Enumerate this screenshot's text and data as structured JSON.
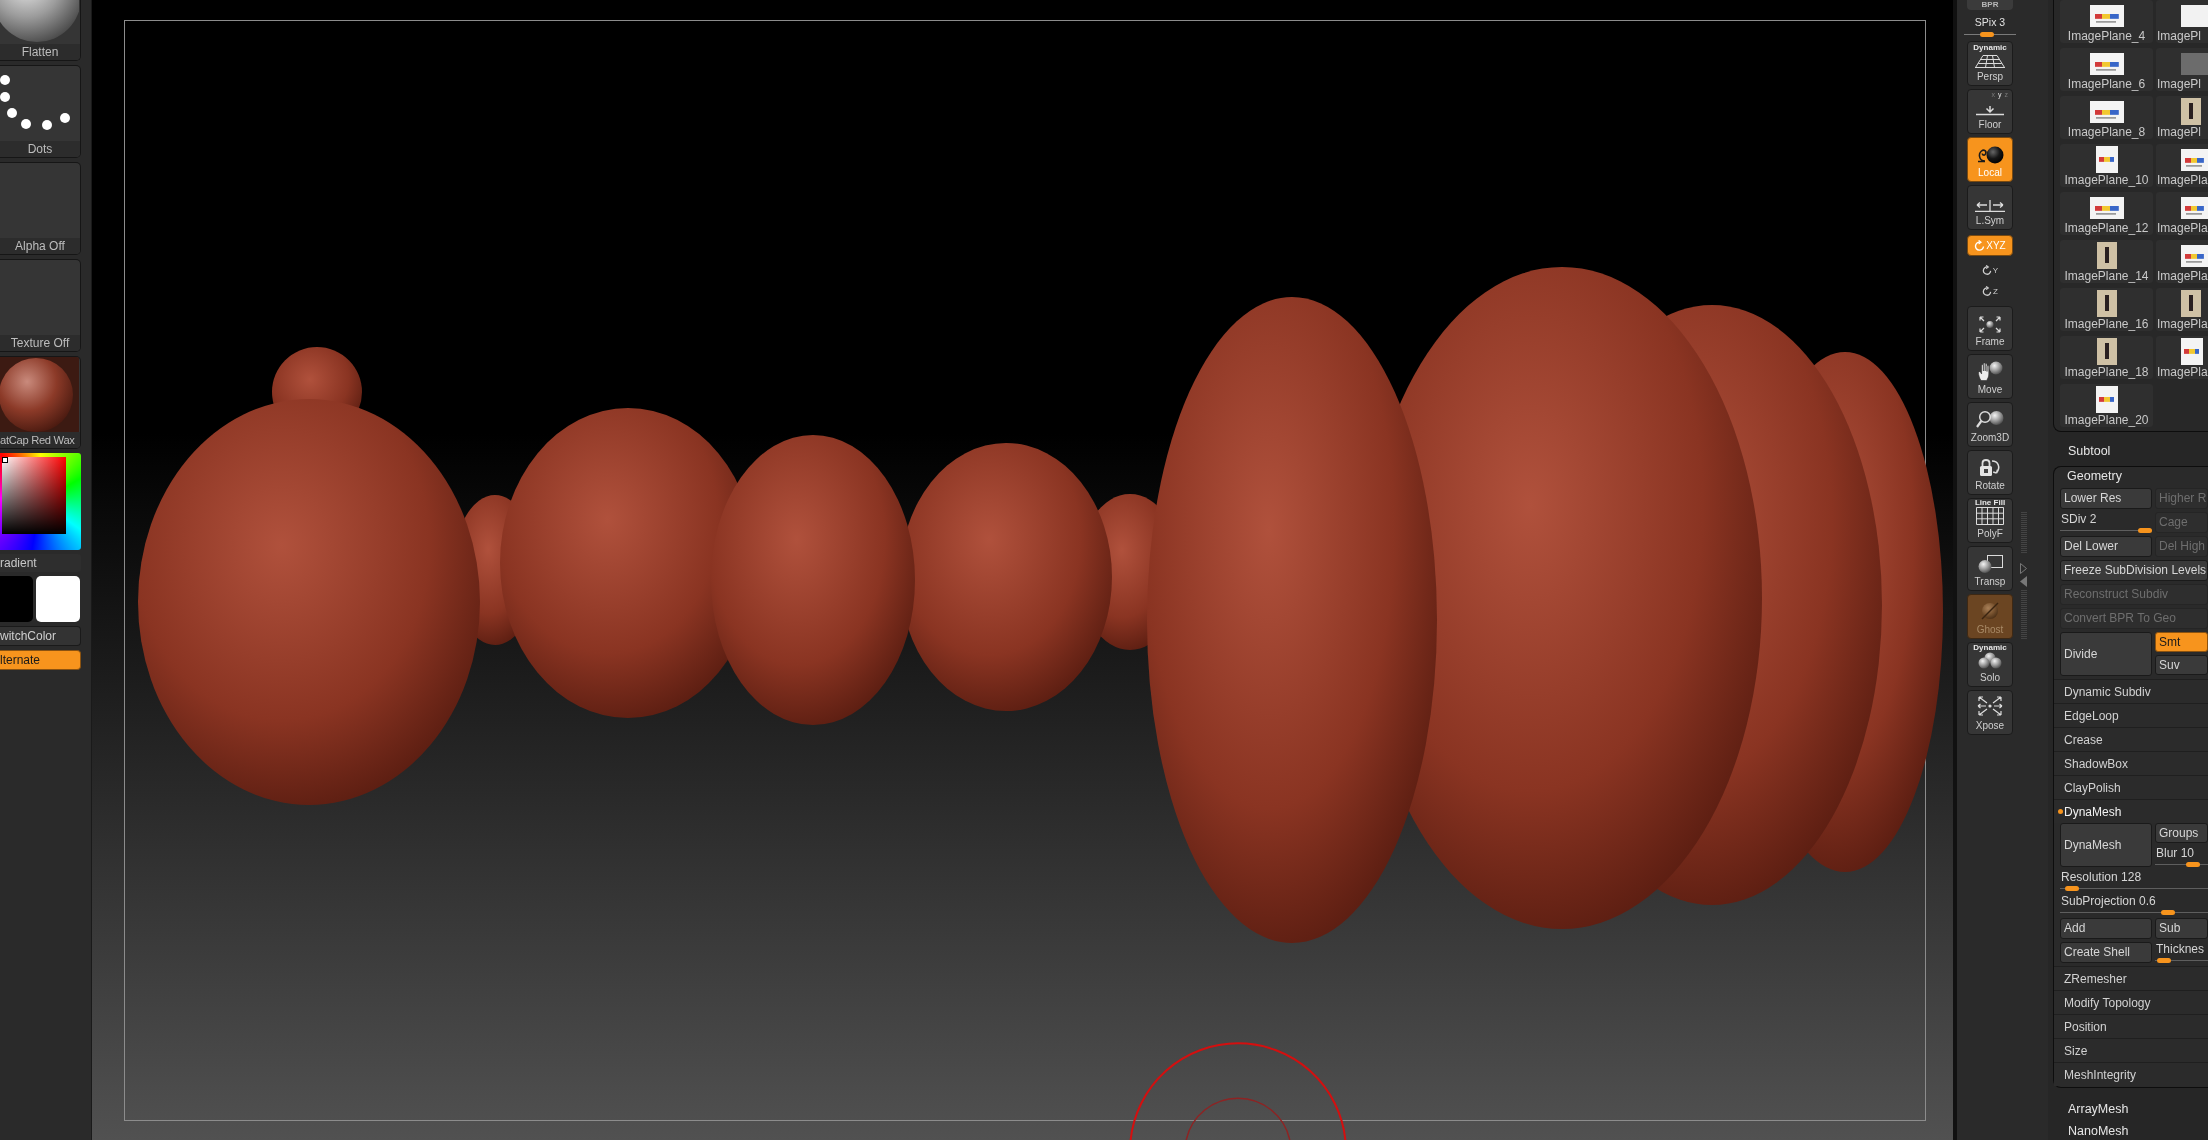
{
  "left_shelf": {
    "tiles": [
      {
        "kind": "sphere",
        "label": "Flatten"
      },
      {
        "kind": "dots",
        "label": "Dots"
      },
      {
        "kind": "empty",
        "label": "Alpha Off"
      },
      {
        "kind": "empty",
        "label": "Texture Off"
      },
      {
        "kind": "matcap",
        "label": "atCap Red Wax"
      }
    ],
    "color_picker": {
      "label": "radient"
    },
    "swatches": [
      {
        "color": "#000000"
      },
      {
        "color": "#ffffff"
      }
    ],
    "switch_button": {
      "label": "witchColor"
    },
    "alternate_button": {
      "label": "lternate",
      "on": true
    }
  },
  "toolbar": {
    "bpr_button": {
      "label": "BPR"
    },
    "spix_slider": {
      "label": "SPix 3",
      "level": 0.42
    },
    "buttons": [
      {
        "kind": "tile",
        "caption": "Dynamic",
        "label": "Persp",
        "on": false,
        "disabled": false
      },
      {
        "kind": "tile",
        "axes": [
          {
            "label": "x",
            "selected": false
          },
          {
            "label": "y",
            "selected": true
          },
          {
            "label": "z",
            "selected": false
          }
        ],
        "label": "Floor",
        "on": false,
        "disabled": false
      },
      {
        "kind": "tile",
        "label": "Local",
        "on": true,
        "disabled": false
      },
      {
        "kind": "tile",
        "label": "L.Sym",
        "on": false,
        "disabled": false
      },
      {
        "kind": "pill",
        "label": "XYZ",
        "on": true,
        "disabled": false
      },
      {
        "kind": "mini",
        "label": "Y",
        "on": false,
        "disabled": false
      },
      {
        "kind": "mini",
        "label": "Z",
        "on": false,
        "disabled": false
      },
      {
        "kind": "tile",
        "label": "Frame",
        "on": false,
        "disabled": false
      },
      {
        "kind": "tile",
        "label": "Move",
        "on": false,
        "disabled": false
      },
      {
        "kind": "tile",
        "label": "Zoom3D",
        "on": false,
        "disabled": false
      },
      {
        "kind": "tile",
        "label": "Rotate",
        "on": false,
        "disabled": false
      },
      {
        "kind": "tile",
        "caption": "Line Fill",
        "label": "PolyF",
        "on": false,
        "disabled": false
      },
      {
        "kind": "tile",
        "label": "Transp",
        "on": false,
        "disabled": false
      },
      {
        "kind": "tile",
        "label": "Ghost",
        "on": true,
        "disabled": true
      },
      {
        "kind": "tile",
        "caption": "Dynamic",
        "label": "Solo",
        "on": false,
        "disabled": false
      },
      {
        "kind": "tile",
        "label": "Xpose",
        "on": false,
        "disabled": false
      }
    ]
  },
  "image_planes": {
    "items": [
      {
        "label": "ImagePlane_4",
        "kind": "diagram-wide"
      },
      {
        "label": "ImagePl",
        "kind": "blank-wide"
      },
      {
        "label": "ImagePlane_6",
        "kind": "diagram-wide"
      },
      {
        "label": "ImagePl",
        "kind": "photo-wide"
      },
      {
        "label": "ImagePlane_8",
        "kind": "diagram-wide"
      },
      {
        "label": "ImagePl",
        "kind": "photo-tall"
      },
      {
        "label": "ImagePlane_10",
        "kind": "diagram-tall"
      },
      {
        "label": "ImagePla",
        "kind": "diagram-wide"
      },
      {
        "label": "ImagePlane_12",
        "kind": "diagram-wide"
      },
      {
        "label": "ImagePla",
        "kind": "diagram-wide"
      },
      {
        "label": "ImagePlane_14",
        "kind": "photo-tall"
      },
      {
        "label": "ImagePla",
        "kind": "diagram-wide"
      },
      {
        "label": "ImagePlane_16",
        "kind": "photo-tall"
      },
      {
        "label": "ImagePla",
        "kind": "photo-tall"
      },
      {
        "label": "ImagePlane_18",
        "kind": "photo-tall"
      },
      {
        "label": "ImagePla",
        "kind": "diagram-tall"
      },
      {
        "label": "ImagePlane_20",
        "kind": "diagram-tall"
      }
    ]
  },
  "subtool_header": {
    "label": "Subtool"
  },
  "geometry": {
    "title": "Geometry",
    "rows": [
      {
        "kind": "pair",
        "cells": [
          {
            "kind": "button",
            "label": "Lower Res",
            "disabled": false
          },
          {
            "kind": "button",
            "label": "Higher R",
            "disabled": true
          }
        ]
      },
      {
        "kind": "pair",
        "cells": [
          {
            "kind": "slider",
            "label": "SDiv 2",
            "level": 1
          },
          {
            "kind": "button",
            "label": "Cage",
            "disabled": true
          }
        ]
      },
      {
        "kind": "pair",
        "cells": [
          {
            "kind": "button",
            "label": "Del Lower",
            "disabled": false
          },
          {
            "kind": "button",
            "label": "Del High",
            "disabled": true
          }
        ]
      },
      {
        "kind": "wide",
        "label": "Freeze SubDivision Levels",
        "disabled": false
      },
      {
        "kind": "wide",
        "label": "Reconstruct Subdiv",
        "disabled": true
      },
      {
        "kind": "wide",
        "label": "Convert BPR To Geo",
        "disabled": true
      },
      {
        "kind": "block",
        "label": "Divide",
        "cells": [
          {
            "kind": "toggle",
            "label": "Smt",
            "on": true
          },
          {
            "kind": "toggle",
            "label": "Suv",
            "on": false
          }
        ]
      },
      {
        "kind": "section",
        "label": "Dynamic Subdiv",
        "active": false
      },
      {
        "kind": "section",
        "label": "EdgeLoop",
        "active": false
      },
      {
        "kind": "section",
        "label": "Crease",
        "active": false
      },
      {
        "kind": "section",
        "label": "ShadowBox",
        "active": false
      },
      {
        "kind": "section",
        "label": "ClayPolish",
        "active": false
      },
      {
        "kind": "section",
        "label": "DynaMesh",
        "active": true
      },
      {
        "kind": "block",
        "label": "DynaMesh",
        "cells": [
          {
            "kind": "toggle",
            "label": "Groups",
            "on": false
          },
          {
            "kind": "slider",
            "label": "Blur 10",
            "level": 0.8
          }
        ]
      },
      {
        "kind": "slider",
        "label": "Resolution 128",
        "level": 0.04
      },
      {
        "kind": "slider",
        "label": "SubProjection 0.6",
        "level": 0.75
      },
      {
        "kind": "pair",
        "cells": [
          {
            "kind": "button",
            "label": "Add",
            "disabled": false
          },
          {
            "kind": "button",
            "label": "Sub",
            "disabled": false
          }
        ]
      },
      {
        "kind": "pair",
        "cells": [
          {
            "kind": "button",
            "label": "Create Shell",
            "disabled": false
          },
          {
            "kind": "slider",
            "label": "Thicknes",
            "level": 0.05
          }
        ]
      },
      {
        "kind": "section",
        "label": "ZRemesher",
        "active": false
      },
      {
        "kind": "section",
        "label": "Modify Topology",
        "active": false
      },
      {
        "kind": "section",
        "label": "Position",
        "active": false
      },
      {
        "kind": "section",
        "label": "Size",
        "active": false
      },
      {
        "kind": "section",
        "label": "MeshIntegrity",
        "active": false
      }
    ]
  },
  "headers_below": [
    {
      "label": "ArrayMesh"
    },
    {
      "label": "NanoMesh"
    }
  ]
}
